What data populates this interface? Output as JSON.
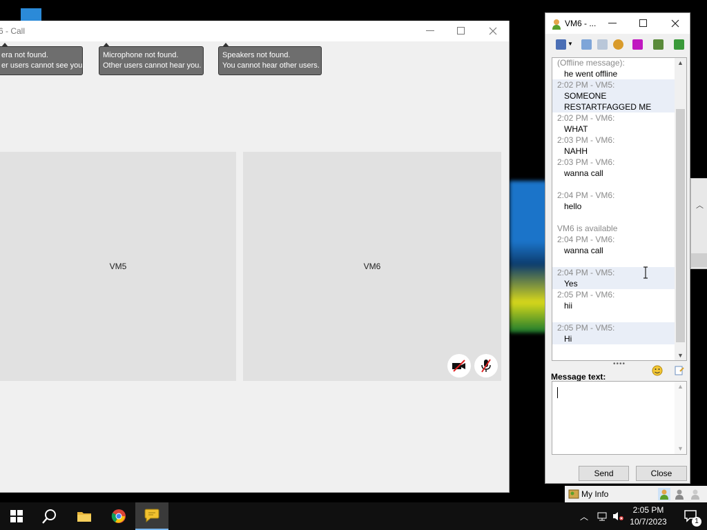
{
  "call_window": {
    "title": "6 - Call",
    "tooltips": [
      {
        "line1": "era not found.",
        "line2": "er users cannot see you."
      },
      {
        "line1": "Microphone not found.",
        "line2": "Other users cannot hear you."
      },
      {
        "line1": "Speakers not found.",
        "line2": "You cannot hear other users."
      }
    ],
    "participants": [
      "VM5",
      "VM6"
    ]
  },
  "chat_window": {
    "title": "VM6 - ...",
    "messages": [
      {
        "header": "(Offline message):",
        "body": "he went offline",
        "hl": false,
        "gap": false
      },
      {
        "header": "2:02 PM - VM5:",
        "body": "SOMEONE",
        "body2": "RESTARTFAGGED ME",
        "hl": true,
        "gap": false
      },
      {
        "header": "2:02 PM - VM6:",
        "body": "WHAT",
        "hl": false,
        "gap": false
      },
      {
        "header": "2:03 PM - VM6:",
        "body": "NAHH",
        "hl": false,
        "gap": false
      },
      {
        "header": "2:03 PM - VM6:",
        "body": "wanna call",
        "hl": false,
        "gap": false
      },
      {
        "header": "2:04 PM - VM6:",
        "body": "hello",
        "hl": false,
        "gap": true
      },
      {
        "header": "VM6 is available",
        "body": "",
        "hl": false,
        "gap": true
      },
      {
        "header": "2:04 PM - VM6:",
        "body": "wanna call",
        "hl": false,
        "gap": false
      },
      {
        "header": "2:04 PM - VM5:",
        "body": "Yes",
        "hl": true,
        "gap": true
      },
      {
        "header": "2:05 PM - VM6:",
        "body": "hii",
        "hl": false,
        "gap": false
      },
      {
        "header": "2:05 PM - VM5:",
        "body": "Hi",
        "hl": true,
        "gap": true
      }
    ],
    "message_label": "Message text:",
    "input_value": "",
    "send_label": "Send",
    "close_label": "Close",
    "my_info_label": "My Info"
  },
  "taskbar": {
    "time": "2:05 PM",
    "date": "10/7/2023",
    "notification_count": "1"
  }
}
